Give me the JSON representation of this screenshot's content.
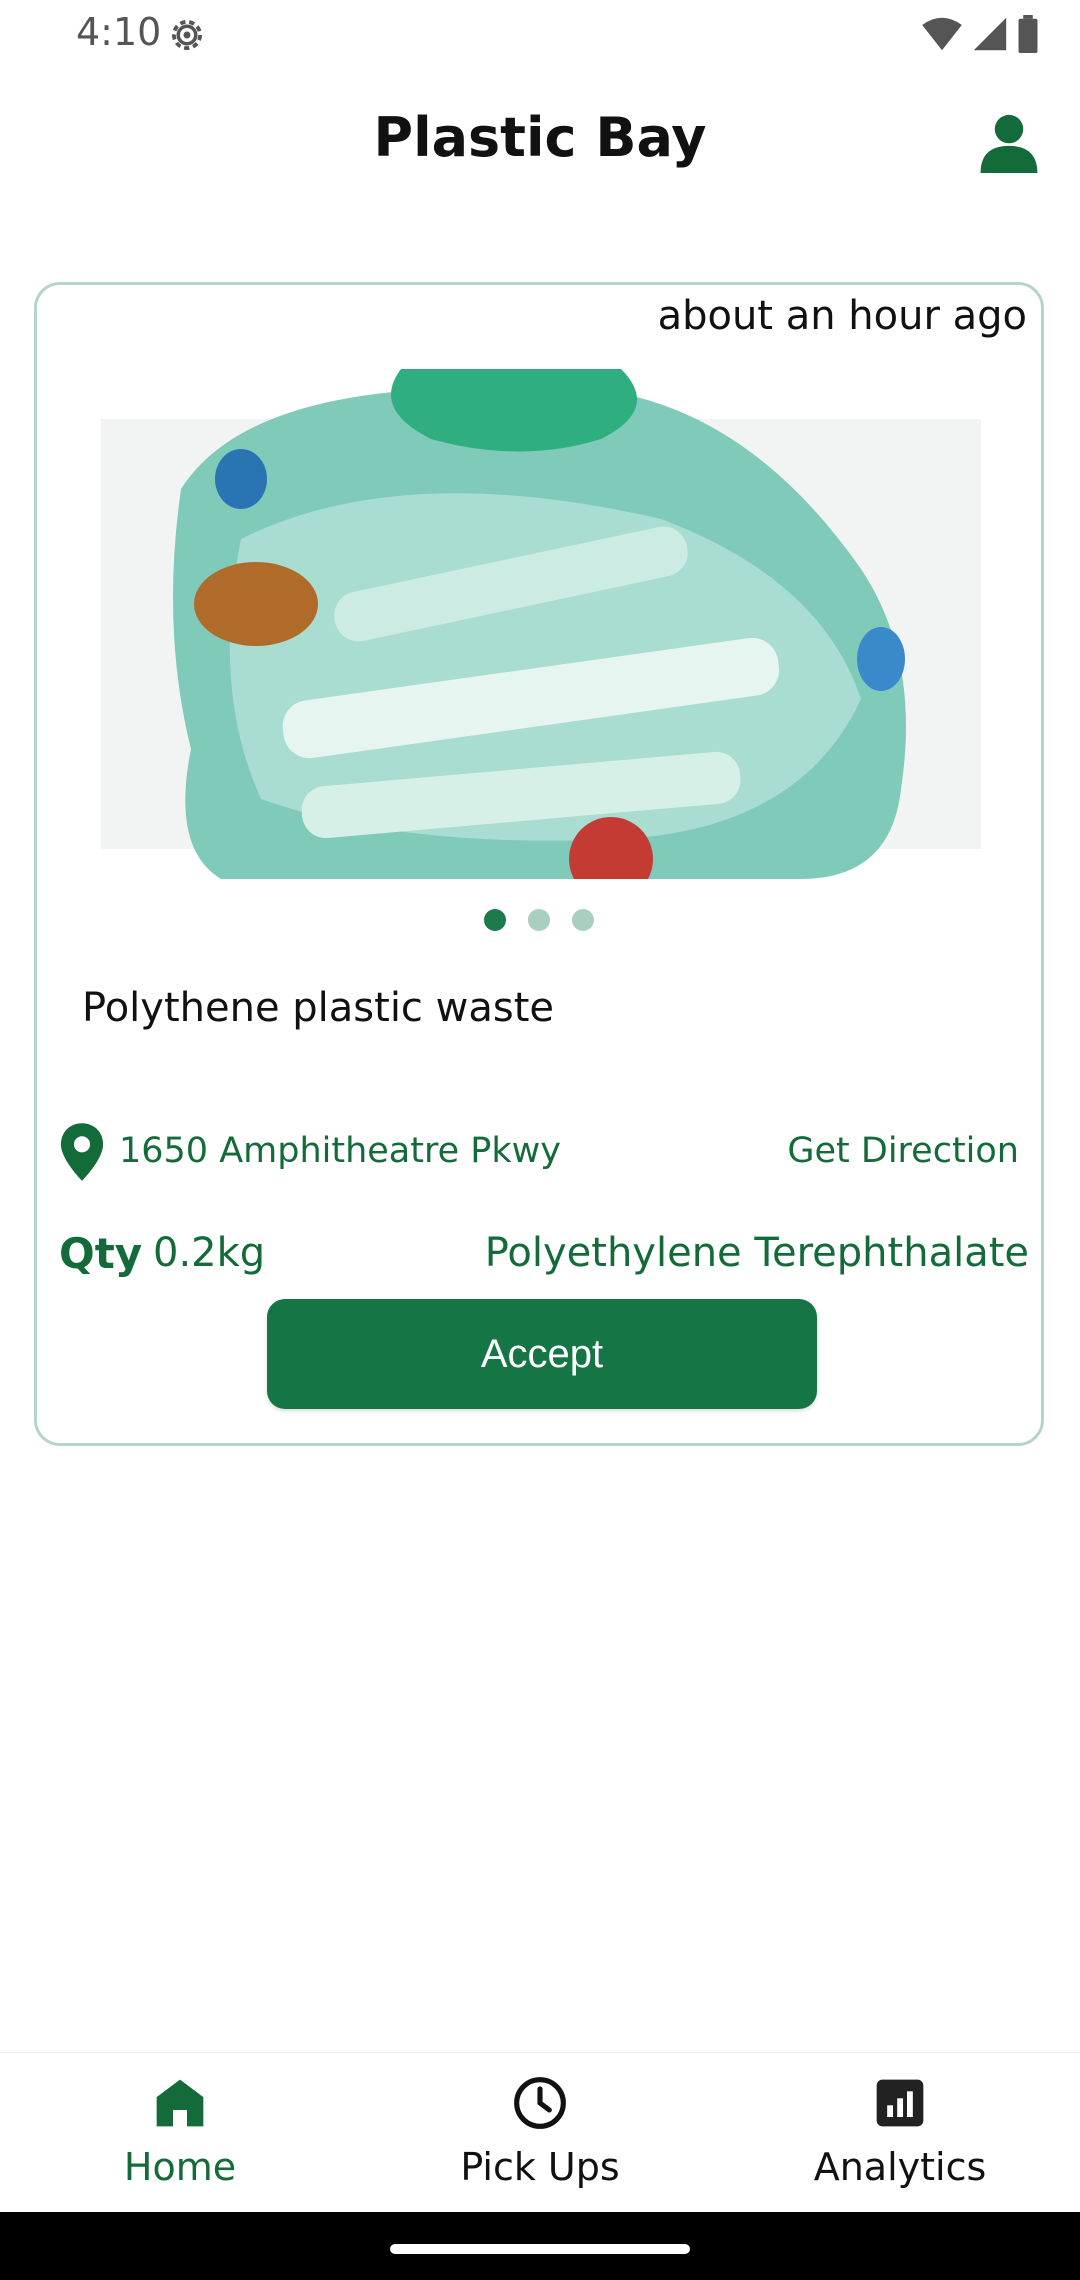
{
  "status_bar": {
    "time": "4:10",
    "icons": [
      "settings-gear-icon",
      "wifi-icon",
      "signal-icon",
      "battery-icon"
    ]
  },
  "header": {
    "title": "Plastic Bay",
    "profile_icon": "person-icon"
  },
  "listing": {
    "posted": "about an hour ago",
    "image_description": "plastic bag of bottles",
    "carousel": {
      "count": 3,
      "active_index": 0
    },
    "title": "Polythene plastic waste",
    "address": "1650 Amphitheatre Pkwy",
    "direction_label": "Get Direction",
    "qty_label": "Qty",
    "qty_value": "0.2kg",
    "material": "Polyethylene Terephthalate",
    "accept_label": "Accept"
  },
  "nav": {
    "items": [
      {
        "label": "Home",
        "icon": "home-icon",
        "active": true
      },
      {
        "label": "Pick Ups",
        "icon": "clock-icon",
        "active": false
      },
      {
        "label": "Analytics",
        "icon": "analytics-icon",
        "active": false
      }
    ]
  },
  "colors": {
    "brand_green": "#146b3a",
    "button_green": "#167545",
    "card_border": "#b3d5cd",
    "dot_inactive": "#a8cfbf"
  }
}
